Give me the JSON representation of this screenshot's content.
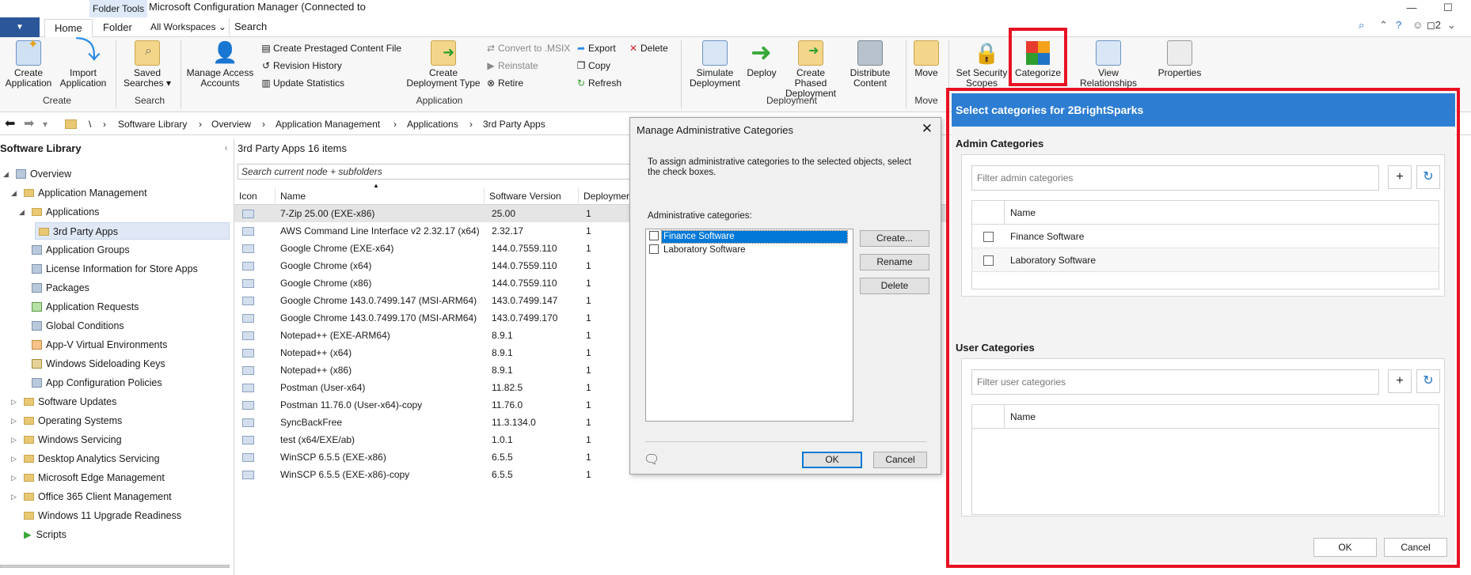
{
  "titlebar": {
    "system_menu": "▼",
    "folder_tools": "Folder Tools",
    "title": "Microsoft Configuration Manager (Connected to",
    "minimize": "—",
    "maximize": "☐",
    "close": "✕"
  },
  "tabs": [
    {
      "label": "Home"
    },
    {
      "label": "Folder"
    }
  ],
  "workspace_dropdown": "All Workspaces",
  "search_box": "Search",
  "notifications": "2",
  "ribbon": {
    "create_application": "Create Application",
    "import_application": "Import Application",
    "group_create": "Create",
    "saved_searches": "Saved Searches",
    "group_search": "Search",
    "manage_access_accounts": "Manage Access Accounts",
    "create_prestaged": "Create Prestaged Content File",
    "revision_history": "Revision History",
    "update_statistics": "Update Statistics",
    "create_deployment_type": "Create Deployment Type",
    "group_application": "Application",
    "convert_msix": "Convert to .MSIX",
    "reinstate": "Reinstate",
    "retire": "Retire",
    "export": "Export",
    "copy": "Copy",
    "refresh": "Refresh",
    "delete": "Delete",
    "simulate_deployment": "Simulate Deployment",
    "deploy": "Deploy",
    "create_phased_deployment": "Create Phased Deployment",
    "distribute_content": "Distribute Content",
    "group_deployment": "Deployment",
    "move": "Move",
    "group_move": "Move",
    "set_security_scopes": "Set Security Scopes",
    "categorize": "Categorize",
    "view_relationships": "View Relationships",
    "properties": "Properties"
  },
  "breadcrumb": [
    "\\",
    "Software Library",
    "Overview",
    "Application Management",
    "Applications",
    "3rd Party Apps"
  ],
  "tree": {
    "title": "Software Library",
    "items": [
      {
        "label": "Overview"
      },
      {
        "label": "Application Management"
      },
      {
        "label": "Applications"
      },
      {
        "label": "3rd Party Apps"
      },
      {
        "label": "Application Groups"
      },
      {
        "label": "License Information for Store Apps"
      },
      {
        "label": "Packages"
      },
      {
        "label": "Application Requests"
      },
      {
        "label": "Global Conditions"
      },
      {
        "label": "App-V Virtual Environments"
      },
      {
        "label": "Windows Sideloading Keys"
      },
      {
        "label": "App Configuration Policies"
      },
      {
        "label": "Software Updates"
      },
      {
        "label": "Operating Systems"
      },
      {
        "label": "Windows Servicing"
      },
      {
        "label": "Desktop Analytics Servicing"
      },
      {
        "label": "Microsoft Edge Management"
      },
      {
        "label": "Office 365 Client Management"
      },
      {
        "label": "Windows 11 Upgrade Readiness"
      },
      {
        "label": "Scripts"
      }
    ]
  },
  "list": {
    "header": "3rd Party Apps 16 items",
    "search_placeholder": "Search current node + subfolders",
    "columns": [
      "Icon",
      "Name",
      "Software Version",
      "Deploymen"
    ],
    "rows": [
      {
        "name": "7-Zip 25.00 (EXE-x86)",
        "version": "25.00",
        "deployments": "1"
      },
      {
        "name": "AWS Command Line Interface v2 2.32.17 (x64)",
        "version": "2.32.17",
        "deployments": "1"
      },
      {
        "name": "Google Chrome (EXE-x64)",
        "version": "144.0.7559.110",
        "deployments": "1"
      },
      {
        "name": "Google Chrome (x64)",
        "version": "144.0.7559.110",
        "deployments": "1"
      },
      {
        "name": "Google Chrome (x86)",
        "version": "144.0.7559.110",
        "deployments": "1"
      },
      {
        "name": "Google Chrome 143.0.7499.147 (MSI-ARM64)",
        "version": "143.0.7499.147",
        "deployments": "1"
      },
      {
        "name": "Google Chrome 143.0.7499.170 (MSI-ARM64)",
        "version": "143.0.7499.170",
        "deployments": "1"
      },
      {
        "name": "Notepad++ (EXE-ARM64)",
        "version": "8.9.1",
        "deployments": "1"
      },
      {
        "name": "Notepad++ (x64)",
        "version": "8.9.1",
        "deployments": "1"
      },
      {
        "name": "Notepad++ (x86)",
        "version": "8.9.1",
        "deployments": "1"
      },
      {
        "name": "Postman (User-x64)",
        "version": "11.82.5",
        "deployments": "1"
      },
      {
        "name": "Postman 11.76.0 (User-x64)-copy",
        "version": "11.76.0",
        "deployments": "1"
      },
      {
        "name": "SyncBackFree",
        "version": "11.3.134.0",
        "deployments": "1"
      },
      {
        "name": "test (x64/EXE/ab)",
        "version": "1.0.1",
        "deployments": "1"
      },
      {
        "name": "WinSCP 6.5.5 (EXE-x86)",
        "version": "6.5.5",
        "deployments": "1"
      },
      {
        "name": "WinSCP 6.5.5 (EXE-x86)-copy",
        "version": "6.5.5",
        "deployments": "1"
      }
    ]
  },
  "manage_dialog": {
    "title": "Manage Administrative Categories",
    "instructions": "To assign administrative categories to the selected objects, select the check boxes.",
    "list_label": "Administrative categories:",
    "items": [
      {
        "label": "Finance Software",
        "checked": false
      },
      {
        "label": "Laboratory Software",
        "checked": false
      }
    ],
    "create": "Create...",
    "rename": "Rename",
    "delete": "Delete",
    "ok": "OK",
    "cancel": "Cancel"
  },
  "select_panel": {
    "title": "Select categories for 2BrightSparks",
    "admin_section": "Admin Categories",
    "admin_filter_placeholder": "Filter admin categories",
    "admin_column": "Name",
    "admin_items": [
      {
        "label": "Finance Software",
        "checked": false
      },
      {
        "label": "Laboratory Software",
        "checked": false
      }
    ],
    "user_section": "User Categories",
    "user_filter_placeholder": "Filter user categories",
    "user_column": "Name",
    "ok": "OK",
    "cancel": "Cancel"
  },
  "colors": {
    "accent": "#2d7dd2",
    "highlight_border": "#e81123",
    "selection": "#0078d7"
  }
}
